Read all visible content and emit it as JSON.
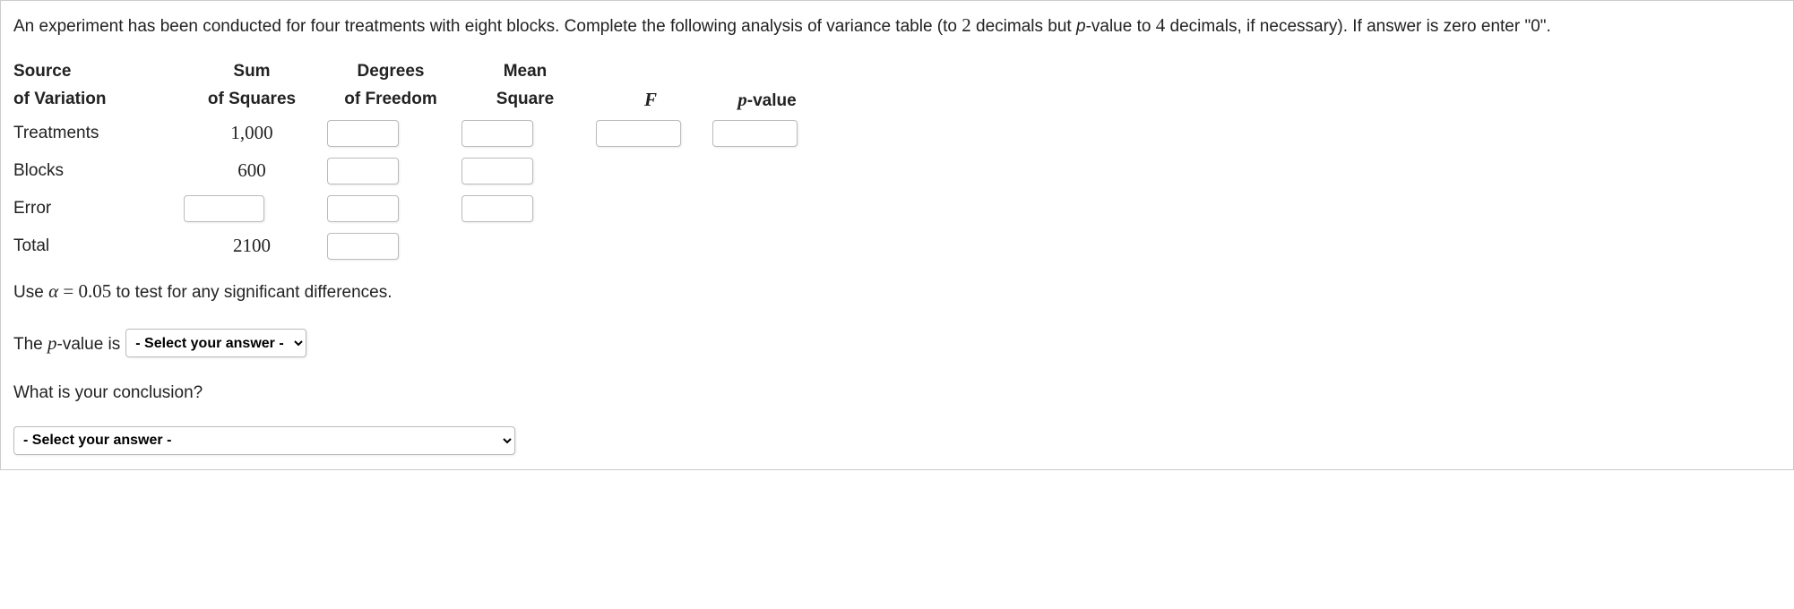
{
  "instr": {
    "part1": "An experiment has been conducted for four treatments with eight blocks. Complete the following analysis of variance table (to ",
    "num1": "2",
    "part2": " decimals but ",
    "pword": "p",
    "part3": "-value to ",
    "num2": "4",
    "part4": " decimals, if necessary). If answer is zero enter \"0\"."
  },
  "headers": {
    "src1": "Source",
    "src2": "of Variation",
    "ss1": "Sum",
    "ss2": "of Squares",
    "df1": "Degrees",
    "df2": "of Freedom",
    "ms1": "Mean",
    "ms2": "Square",
    "f": "F",
    "p1": "p",
    "p2": "-value"
  },
  "rows": {
    "treat": {
      "label": "Treatments",
      "ss": "1,000"
    },
    "blocks": {
      "label": "Blocks",
      "ss": "600"
    },
    "error": {
      "label": "Error"
    },
    "total": {
      "label": "Total",
      "ss": "2100"
    }
  },
  "alpha_line": {
    "p1": "Use ",
    "var": "α",
    "eq": " = ",
    "val": "0.05",
    "p2": " to test for any significant differences."
  },
  "pval_line": {
    "p1": "The ",
    "pword": "p",
    "p2": "-value is"
  },
  "select_placeholder": "- Select your answer -",
  "conclusion_q": "What is your conclusion?"
}
